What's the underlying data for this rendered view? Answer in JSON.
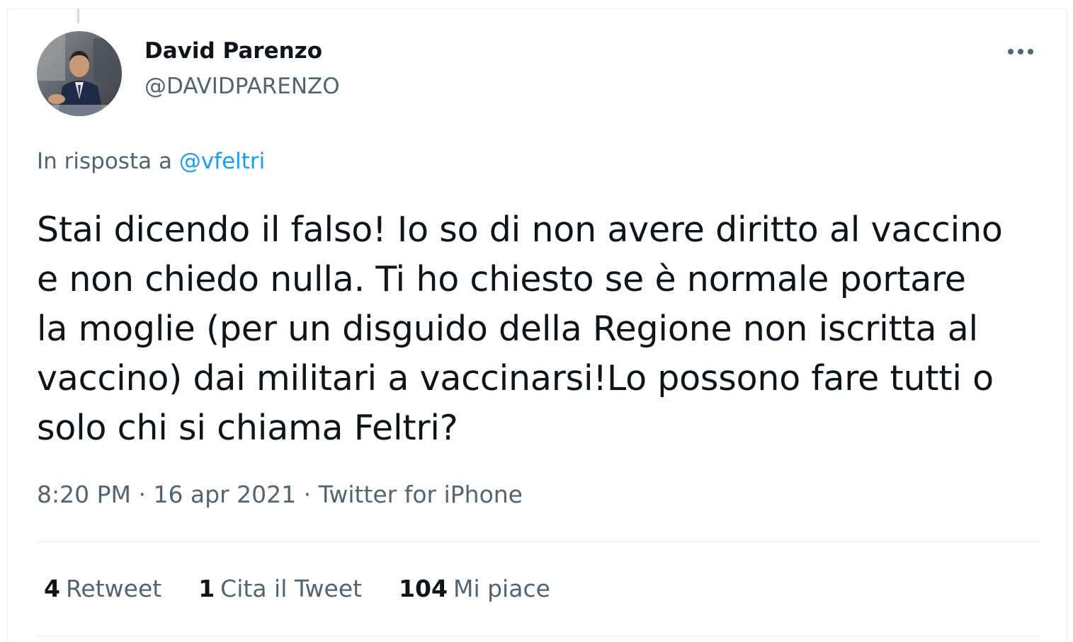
{
  "tweet": {
    "author": {
      "display_name": "David Parenzo",
      "handle": "@DAVIDPARENZO"
    },
    "reply_to": {
      "prefix": "In risposta a",
      "mention": "@vfeltri"
    },
    "text_lines": [
      "Stai dicendo il falso! Io so di non avere diritto al vaccino",
      "e non chiedo nulla. Ti ho chiesto se è normale portare",
      "la moglie (per un disguido della Regione non iscritta al",
      "vaccino) dai militari a vaccinarsi!Lo possono fare tutti o",
      "solo chi si chiama Feltri?"
    ],
    "meta": {
      "time": "8:20 PM",
      "sep1": " · ",
      "date": "16 apr 2021",
      "sep2": " · ",
      "source": "Twitter for iPhone"
    },
    "stats": [
      {
        "count": "4",
        "label": "Retweet"
      },
      {
        "count": "1",
        "label": "Cita il Tweet"
      },
      {
        "count": "104",
        "label": "Mi piace"
      }
    ]
  },
  "icons": {
    "more": "more-horizontal-icon"
  },
  "colors": {
    "text_primary": "#0f1419",
    "text_secondary": "#536471",
    "link": "#1d9bf0",
    "border": "#ebeef0"
  }
}
